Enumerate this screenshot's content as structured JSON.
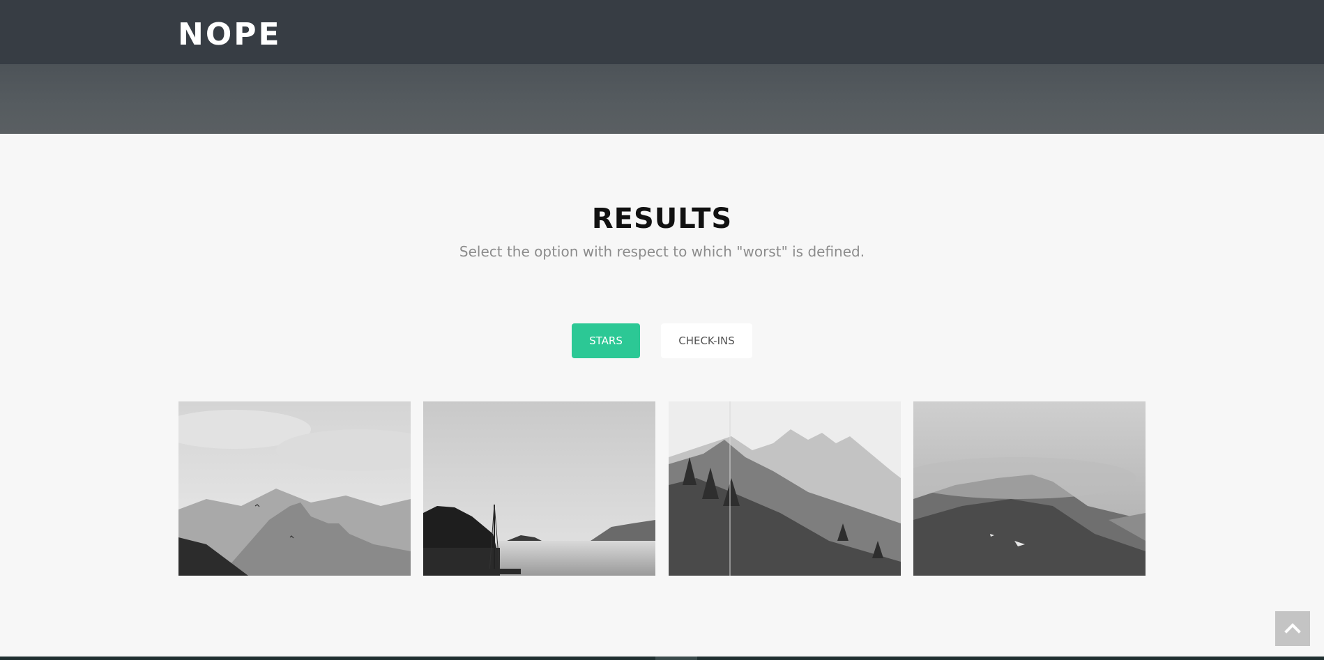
{
  "navbar": {
    "logo": "NOPE"
  },
  "results": {
    "title": "RESULTS",
    "subtitle": "Select the option with respect to which \"worst\" is defined.",
    "filters": [
      {
        "label": "STARS",
        "active": true
      },
      {
        "label": "CHECK-INS",
        "active": false
      }
    ]
  },
  "gallery": {
    "images": [
      {
        "subject": "mountain ridge with paragliders, grayscale"
      },
      {
        "subject": "lake with boat mast, grayscale"
      },
      {
        "subject": "forested mountain slope, grayscale"
      },
      {
        "subject": "misty mountain, grayscale"
      }
    ]
  },
  "icons": {
    "back_to_top": "chevron-up-icon"
  },
  "colors": {
    "navbar": "#373d44",
    "accent": "#2cc895",
    "background": "#f7f7f7"
  }
}
